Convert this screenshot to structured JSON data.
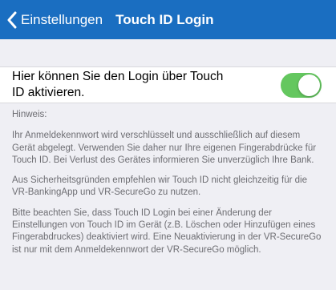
{
  "nav": {
    "back_label": "Einstellungen",
    "title": "Touch ID Login"
  },
  "setting": {
    "label": "Hier können Sie den Login über Touch ID aktivieren.",
    "toggle_on": true,
    "toggle_color": "#64c75f"
  },
  "notes": {
    "heading": "Hinweis:",
    "paragraph1": "Ihr Anmeldekennwort wird verschlüsselt und ausschließlich auf diesem Gerät abgelegt. Verwenden Sie daher nur Ihre eigenen Fingerabdrücke für Touch ID.  Bei Verlust des Gerätes informieren Sie unverzüglich Ihre Bank.",
    "paragraph2": "Aus Sicherheitsgründen empfehlen wir Touch ID nicht gleichzeitig für die VR-BankingApp und VR-SecureGo zu nutzen.",
    "paragraph3": "Bitte beachten Sie, dass Touch ID Login bei einer Änderung der Einstellungen von Touch ID im Gerät (z.B. Löschen oder Hinzufügen eines Fingerabdruckes) deaktiviert wird. Eine Neuaktivierung in der VR-SecureGo ist nur mit dem Anmeldekennwort der VR-SecureGo möglich."
  },
  "colors": {
    "nav_background": "#1a6ec1",
    "page_background": "#efeff4"
  }
}
